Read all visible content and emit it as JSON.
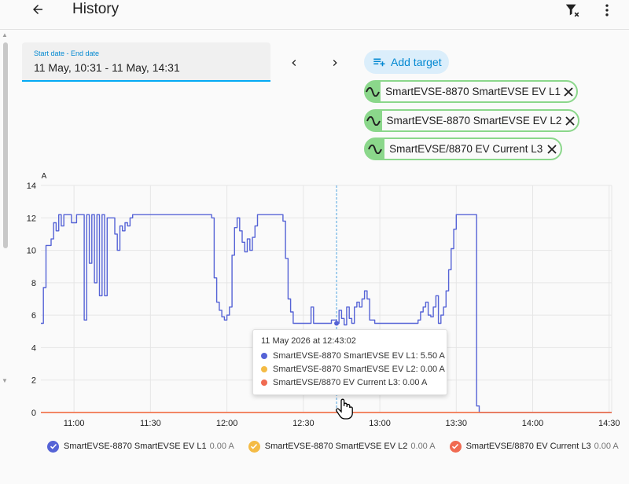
{
  "header": {
    "title": "History",
    "back_icon": "arrow-left-icon",
    "filter_icon": "filter-remove-icon",
    "more_icon": "dots-vertical-icon"
  },
  "date_range": {
    "label": "Start date - End date",
    "value": "11 May, 10:31 - 11 May, 14:31"
  },
  "add_target": {
    "label": "Add target",
    "icon": "playlist-plus-icon"
  },
  "targets": [
    {
      "label": "SmartEVSE-8870 SmartEVSE EV L1"
    },
    {
      "label": "SmartEVSE-8870 SmartEVSE EV L2"
    },
    {
      "label": "SmartEVSE/8870 EV Current L3"
    }
  ],
  "colors": {
    "accent": "#03a9f4",
    "chip_green": "#8bd78b",
    "series_l1": "#5563d6",
    "series_l2": "#f4bb45",
    "series_l3": "#f06b52"
  },
  "tooltip": {
    "title": "11 May 2026 at 12:43:02",
    "rows": [
      "SmartEVSE-8870 SmartEVSE EV L1: 5.50 A",
      "SmartEVSE-8870 SmartEVSE EV L2: 0.00 A",
      "SmartEVSE/8870 EV Current L3: 0.00 A"
    ]
  },
  "legend": [
    {
      "name": "SmartEVSE-8870 SmartEVSE EV L1",
      "value": "0.00 A"
    },
    {
      "name": "SmartEVSE-8870 SmartEVSE EV L2",
      "value": "0.00 A"
    },
    {
      "name": "SmartEVSE/8870 EV Current L3",
      "value": "0.00 A"
    }
  ],
  "chart_data": {
    "type": "line",
    "ylabel": "A",
    "ylim": [
      0,
      14
    ],
    "yticks": [
      "0",
      "2",
      "4",
      "6",
      "8",
      "10",
      "12",
      "14"
    ],
    "xticks": [
      "11:00",
      "11:30",
      "12:00",
      "12:30",
      "13:00",
      "13:30",
      "14:00",
      "14:30"
    ],
    "xlim": [
      "10:47",
      "14:31"
    ],
    "grid": true,
    "hover_time": "12:43:02",
    "series": [
      {
        "name": "SmartEVSE-8870 SmartEVSE EV L1",
        "points": [
          [
            "10:47",
            5.5
          ],
          [
            "10:48",
            5.5
          ],
          [
            "10:48",
            7.7
          ],
          [
            "10:49",
            7.7
          ],
          [
            "10:49",
            10.3
          ],
          [
            "10:51",
            10.3
          ],
          [
            "10:51",
            10.7
          ],
          [
            "10:52",
            10.7
          ],
          [
            "10:52",
            11.7
          ],
          [
            "10:53",
            11.7
          ],
          [
            "10:53",
            11.2
          ],
          [
            "10:54",
            11.2
          ],
          [
            "10:54",
            12.2
          ],
          [
            "10:55",
            12.2
          ],
          [
            "10:55",
            11.5
          ],
          [
            "10:56",
            11.5
          ],
          [
            "10:56",
            12.2
          ],
          [
            "10:59",
            12.2
          ],
          [
            "10:59",
            11.7
          ],
          [
            "11:01",
            11.7
          ],
          [
            "11:01",
            12.2
          ],
          [
            "11:04",
            12.2
          ],
          [
            "11:04",
            5.7
          ],
          [
            "11:05",
            5.7
          ],
          [
            "11:05",
            12.2
          ],
          [
            "11:06",
            12.2
          ],
          [
            "11:06",
            9.2
          ],
          [
            "11:07",
            9.2
          ],
          [
            "11:07",
            12.2
          ],
          [
            "11:08",
            12.2
          ],
          [
            "11:08",
            8.0
          ],
          [
            "11:09",
            8.0
          ],
          [
            "11:09",
            12.2
          ],
          [
            "11:10",
            12.2
          ],
          [
            "11:10",
            7.2
          ],
          [
            "11:11",
            7.2
          ],
          [
            "11:11",
            12.2
          ],
          [
            "11:12",
            12.2
          ],
          [
            "11:12",
            7.2
          ],
          [
            "11:13",
            7.2
          ],
          [
            "11:13",
            12.0
          ],
          [
            "11:16",
            12.0
          ],
          [
            "11:16",
            11.0
          ],
          [
            "11:17",
            11.0
          ],
          [
            "11:17",
            10.0
          ],
          [
            "11:18",
            10.0
          ],
          [
            "11:18",
            11.5
          ],
          [
            "11:19",
            11.5
          ],
          [
            "11:19",
            11.2
          ],
          [
            "11:20",
            11.2
          ],
          [
            "11:20",
            11.7
          ],
          [
            "11:21",
            11.7
          ],
          [
            "11:21",
            11.5
          ],
          [
            "11:22",
            11.5
          ],
          [
            "11:22",
            12.0
          ],
          [
            "11:23",
            12.0
          ],
          [
            "11:23",
            12.2
          ],
          [
            "11:54",
            12.2
          ],
          [
            "11:54",
            12.0
          ],
          [
            "11:55",
            12.0
          ],
          [
            "11:55",
            8.3
          ],
          [
            "11:56",
            8.3
          ],
          [
            "11:56",
            6.8
          ],
          [
            "11:57",
            6.8
          ],
          [
            "11:57",
            6.3
          ],
          [
            "11:58",
            6.3
          ],
          [
            "11:58",
            5.9
          ],
          [
            "11:59",
            5.9
          ],
          [
            "11:59",
            5.7
          ],
          [
            "12:00",
            5.7
          ],
          [
            "12:00",
            6.0
          ],
          [
            "12:01",
            6.0
          ],
          [
            "12:01",
            6.5
          ],
          [
            "12:02",
            6.5
          ],
          [
            "12:02",
            9.7
          ],
          [
            "12:03",
            9.7
          ],
          [
            "12:03",
            11.4
          ],
          [
            "12:04",
            11.4
          ],
          [
            "12:04",
            12.0
          ],
          [
            "12:05",
            12.0
          ],
          [
            "12:05",
            11.2
          ],
          [
            "12:06",
            11.2
          ],
          [
            "12:06",
            10.5
          ],
          [
            "12:07",
            10.5
          ],
          [
            "12:07",
            9.9
          ],
          [
            "12:08",
            9.9
          ],
          [
            "12:08",
            10.7
          ],
          [
            "12:09",
            10.7
          ],
          [
            "12:09",
            10.0
          ],
          [
            "12:10",
            10.0
          ],
          [
            "12:10",
            10.8
          ],
          [
            "12:11",
            10.8
          ],
          [
            "12:11",
            11.5
          ],
          [
            "12:12",
            11.5
          ],
          [
            "12:12",
            12.2
          ],
          [
            "12:22",
            12.2
          ],
          [
            "12:22",
            11.8
          ],
          [
            "12:23",
            11.8
          ],
          [
            "12:23",
            9.5
          ],
          [
            "12:24",
            9.5
          ],
          [
            "12:24",
            7.0
          ],
          [
            "12:25",
            7.0
          ],
          [
            "12:25",
            6.2
          ],
          [
            "12:26",
            6.2
          ],
          [
            "12:26",
            5.5
          ],
          [
            "12:33",
            5.5
          ],
          [
            "12:33",
            6.5
          ],
          [
            "12:34",
            6.5
          ],
          [
            "12:34",
            5.5
          ],
          [
            "12:41",
            5.5
          ],
          [
            "12:41",
            5.7
          ],
          [
            "12:43",
            5.7
          ],
          [
            "12:43",
            5.5
          ],
          [
            "12:44",
            5.5
          ],
          [
            "12:44",
            6.3
          ],
          [
            "12:45",
            6.3
          ],
          [
            "12:45",
            5.8
          ],
          [
            "12:46",
            5.8
          ],
          [
            "12:46",
            5.4
          ],
          [
            "12:47",
            5.4
          ],
          [
            "12:47",
            6.5
          ],
          [
            "12:48",
            6.5
          ],
          [
            "12:48",
            5.8
          ],
          [
            "12:49",
            5.8
          ],
          [
            "12:49",
            5.5
          ],
          [
            "12:50",
            5.5
          ],
          [
            "12:50",
            6.5
          ],
          [
            "12:51",
            6.5
          ],
          [
            "12:51",
            6.8
          ],
          [
            "12:52",
            6.8
          ],
          [
            "12:52",
            6.5
          ],
          [
            "12:53",
            6.5
          ],
          [
            "12:53",
            7.0
          ],
          [
            "12:54",
            7.0
          ],
          [
            "12:54",
            7.5
          ],
          [
            "12:55",
            7.5
          ],
          [
            "12:55",
            7.0
          ],
          [
            "12:56",
            7.0
          ],
          [
            "12:56",
            5.7
          ],
          [
            "12:58",
            5.7
          ],
          [
            "12:58",
            5.5
          ],
          [
            "13:15",
            5.5
          ],
          [
            "13:15",
            5.7
          ],
          [
            "13:16",
            5.7
          ],
          [
            "13:16",
            6.2
          ],
          [
            "13:17",
            6.2
          ],
          [
            "13:17",
            6.5
          ],
          [
            "13:18",
            6.5
          ],
          [
            "13:18",
            6.8
          ],
          [
            "13:19",
            6.8
          ],
          [
            "13:19",
            6.0
          ],
          [
            "13:20",
            6.0
          ],
          [
            "13:20",
            5.9
          ],
          [
            "13:21",
            5.9
          ],
          [
            "13:21",
            6.5
          ],
          [
            "13:22",
            6.5
          ],
          [
            "13:22",
            7.2
          ],
          [
            "13:23",
            7.2
          ],
          [
            "13:23",
            5.5
          ],
          [
            "13:24",
            5.5
          ],
          [
            "13:24",
            6.0
          ],
          [
            "13:25",
            6.0
          ],
          [
            "13:25",
            6.5
          ],
          [
            "13:26",
            6.5
          ],
          [
            "13:26",
            7.5
          ],
          [
            "13:27",
            7.5
          ],
          [
            "13:27",
            8.8
          ],
          [
            "13:28",
            8.8
          ],
          [
            "13:28",
            10.1
          ],
          [
            "13:29",
            10.1
          ],
          [
            "13:29",
            11.3
          ],
          [
            "13:30",
            11.3
          ],
          [
            "13:30",
            12.2
          ],
          [
            "13:38",
            12.2
          ],
          [
            "13:38",
            0.4
          ],
          [
            "13:39",
            0.4
          ],
          [
            "13:39",
            0.0
          ],
          [
            "14:31",
            0.0
          ]
        ]
      },
      {
        "name": "SmartEVSE-8870 SmartEVSE EV L2",
        "points": [
          [
            "10:47",
            0
          ],
          [
            "14:31",
            0
          ]
        ]
      },
      {
        "name": "SmartEVSE/8870 EV Current L3",
        "points": [
          [
            "10:47",
            0
          ],
          [
            "14:31",
            0
          ]
        ]
      }
    ]
  }
}
